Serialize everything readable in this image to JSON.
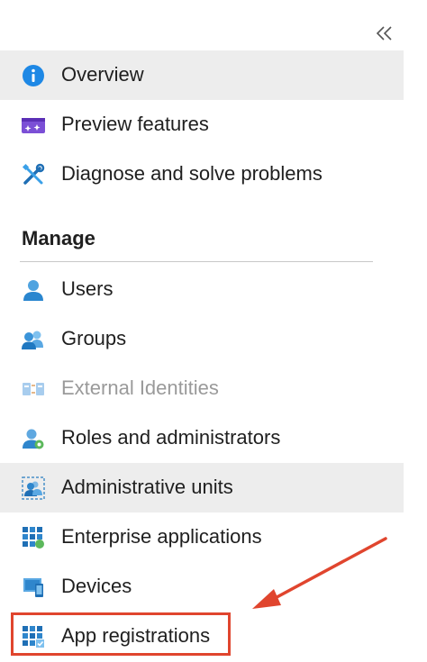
{
  "sidebar": {
    "collapse_glyph": "«",
    "items": [
      {
        "label": "Overview",
        "icon": "info-icon",
        "selected": true
      },
      {
        "label": "Preview features",
        "icon": "preview-features-icon"
      },
      {
        "label": "Diagnose and solve problems",
        "icon": "wrench-screwdriver-icon"
      }
    ],
    "manage": {
      "header": "Manage",
      "items": [
        {
          "label": "Users",
          "icon": "user-icon"
        },
        {
          "label": "Groups",
          "icon": "groups-icon"
        },
        {
          "label": "External Identities",
          "icon": "external-identities-icon",
          "disabled": true
        },
        {
          "label": "Roles and administrators",
          "icon": "roles-icon"
        },
        {
          "label": "Administrative units",
          "icon": "admin-units-icon",
          "hovered": true
        },
        {
          "label": "Enterprise applications",
          "icon": "enterprise-apps-icon"
        },
        {
          "label": "Devices",
          "icon": "devices-icon"
        },
        {
          "label": "App registrations",
          "icon": "app-registrations-icon",
          "highlighted": true
        }
      ]
    }
  },
  "annotation": {
    "highlight_color": "#e0452e"
  },
  "colors": {
    "selected_bg": "#ededed",
    "accent_blue": "#0078d4",
    "disabled_text": "#9a9a9a"
  }
}
